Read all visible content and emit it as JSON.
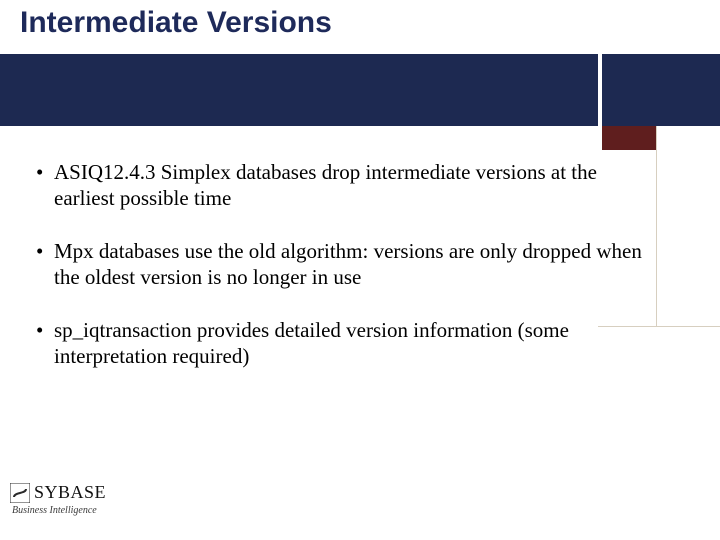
{
  "colors": {
    "navy": "#1d2951",
    "maroon": "#5f1e1e",
    "title": "#1e2a5a"
  },
  "title": "Intermediate Versions",
  "bullets": [
    "ASIQ12.4.3 Simplex databases drop intermediate versions at the earliest possible time",
    "Mpx databases use the old algorithm: versions are only dropped when the oldest version is no longer in use",
    "sp_iqtransaction provides detailed version information (some interpretation required)"
  ],
  "logo": {
    "brand": "SYBASE",
    "tagline": "Business Intelligence"
  }
}
